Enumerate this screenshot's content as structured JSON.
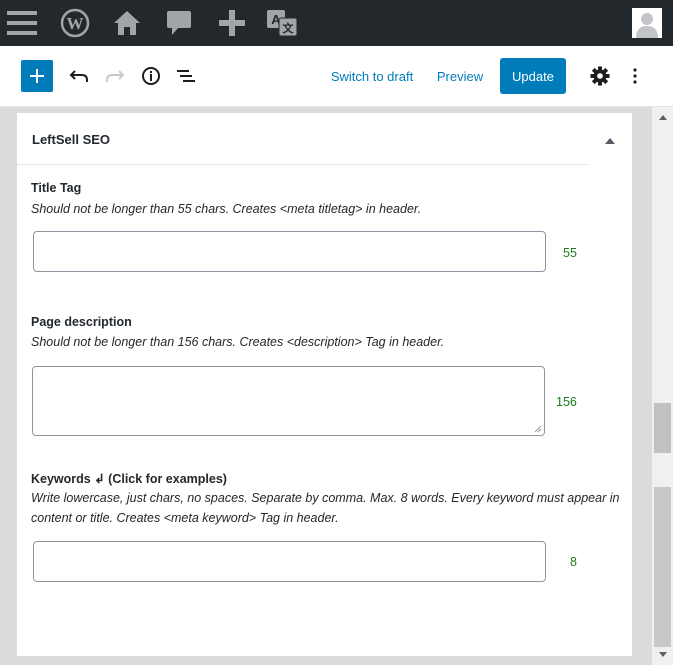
{
  "adminbar": {
    "icons": [
      "menu-icon",
      "wordpress-logo-icon",
      "home-icon",
      "comment-icon",
      "add-new-icon",
      "translate-icon",
      "avatar"
    ]
  },
  "toolbar": {
    "switch_to_draft": "Switch to draft",
    "preview": "Preview",
    "update": "Update"
  },
  "panel": {
    "title": "LeftSell SEO",
    "title_tag": {
      "label": "Title Tag",
      "help": "Should not be longer than 55 chars. Creates <meta titletag> in header.",
      "value": "",
      "counter": "55"
    },
    "description": {
      "label": "Page description",
      "help": "Should not be longer than 156 chars. Creates <description> Tag in header.",
      "value": "",
      "counter": "156"
    },
    "keywords": {
      "label": "Keywords ↲ (Click for examples)",
      "help_line1": "Write lowercase, just chars, no spaces. Separate by comma. Max. 8 words. Every keyword must appear in",
      "help_line2": "content or title. Creates <meta keyword> Tag in header.",
      "value": "",
      "counter": "8"
    }
  },
  "colors": {
    "adminbar": "#23282d",
    "accent": "#007cba",
    "counter": "#1e7a1e"
  }
}
